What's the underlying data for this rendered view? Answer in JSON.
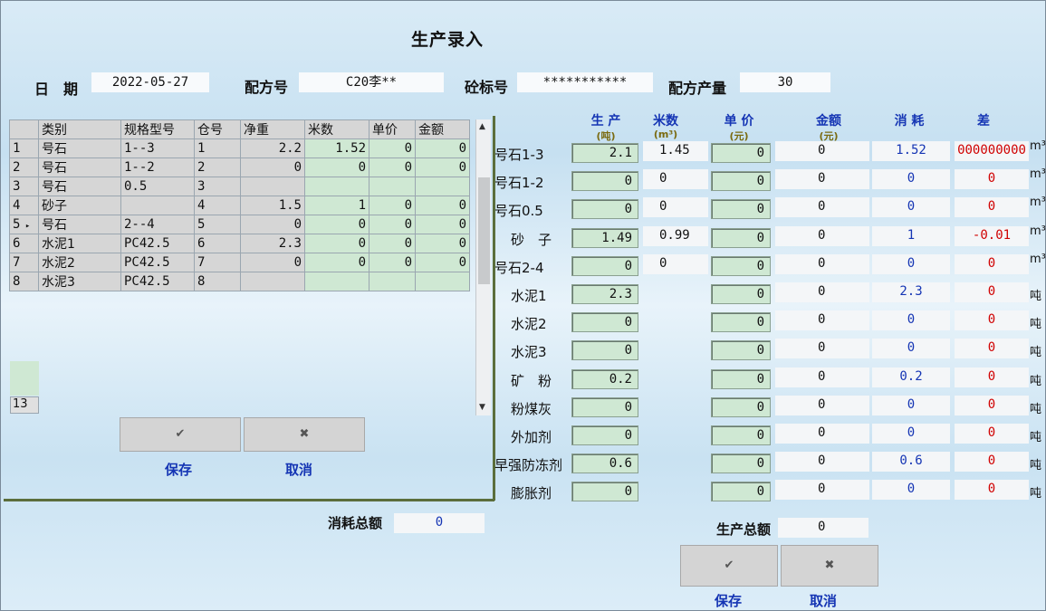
{
  "title": "生产录入",
  "header": {
    "date_label": "日　期",
    "date_value": "2022-05-27",
    "recipe_label": "配方号",
    "recipe_value": "C20李**",
    "grade_label": "砼标号",
    "grade_value": "***********",
    "output_label": "配方产量",
    "output_value": "30"
  },
  "grid": {
    "columns": [
      "类别",
      "规格型号",
      "仓号",
      "净重",
      "米数",
      "单价",
      "金额"
    ],
    "rows": [
      {
        "idx": "1",
        "cat": "号石",
        "spec": "1--3",
        "bin": "1",
        "net": "2.2",
        "m": "1.52",
        "price": "0",
        "amount": "0"
      },
      {
        "idx": "2",
        "cat": "号石",
        "spec": "1--2",
        "bin": "2",
        "net": "0",
        "m": "0",
        "price": "0",
        "amount": "0"
      },
      {
        "idx": "3",
        "cat": "号石",
        "spec": "0.5",
        "bin": "3",
        "net": "",
        "m": "",
        "price": "",
        "amount": ""
      },
      {
        "idx": "4",
        "cat": "砂子",
        "spec": "",
        "bin": "4",
        "net": "1.5",
        "m": "1",
        "price": "0",
        "amount": "0"
      },
      {
        "idx": "5",
        "cat": "号石",
        "spec": "2--4",
        "bin": "5",
        "net": "0",
        "m": "0",
        "price": "0",
        "amount": "0"
      },
      {
        "idx": "6",
        "cat": "水泥1",
        "spec": "PC42.5",
        "bin": "6",
        "net": "2.3",
        "m": "0",
        "price": "0",
        "amount": "0"
      },
      {
        "idx": "7",
        "cat": "水泥2",
        "spec": "PC42.5",
        "bin": "7",
        "net": "0",
        "m": "0",
        "price": "0",
        "amount": "0"
      },
      {
        "idx": "8",
        "cat": "水泥3",
        "spec": "PC42.5",
        "bin": "8",
        "net": "",
        "m": "",
        "price": "",
        "amount": ""
      }
    ],
    "row13_idx": "13"
  },
  "left_buttons": {
    "ok_glyph": "✔",
    "cancel_glyph": "✖",
    "save_label": "保存",
    "cancel_label": "取消"
  },
  "consume_total_label": "消耗总额",
  "consume_total_value": "0",
  "right": {
    "col_headers": {
      "prod": "生 产",
      "prod_unit": "(吨)",
      "meters": "米数",
      "meters_unit": "(m³)",
      "price": "单 价",
      "price_unit": "(元)",
      "amount": "金额",
      "amount_unit": "(元)",
      "consume": "消 耗",
      "diff": "差"
    },
    "rows": [
      {
        "label": "号石1-3",
        "prod": "2.1",
        "meters": "1.45",
        "price": "0",
        "amount": "0",
        "consume": "1.52",
        "diff": "000000000",
        "unit": "m³"
      },
      {
        "label": "号石1-2",
        "prod": "0",
        "meters": "0",
        "price": "0",
        "amount": "0",
        "consume": "0",
        "diff": "0",
        "unit": "m³"
      },
      {
        "label": "号石0.5",
        "prod": "0",
        "meters": "0",
        "price": "0",
        "amount": "0",
        "consume": "0",
        "diff": "0",
        "unit": "m³"
      },
      {
        "label": "砂　子",
        "prod": "1.49",
        "meters": "0.99",
        "price": "0",
        "amount": "0",
        "consume": "1",
        "diff": "-0.01",
        "unit": "m³"
      },
      {
        "label": "号石2-4",
        "prod": "0",
        "meters": "0",
        "price": "0",
        "amount": "0",
        "consume": "0",
        "diff": "0",
        "unit": "m³"
      },
      {
        "label": "水泥1",
        "prod": "2.3",
        "price": "0",
        "amount": "0",
        "consume": "2.3",
        "diff": "0",
        "unit": "吨"
      },
      {
        "label": "水泥2",
        "prod": "0",
        "price": "0",
        "amount": "0",
        "consume": "0",
        "diff": "0",
        "unit": "吨"
      },
      {
        "label": "水泥3",
        "prod": "0",
        "price": "0",
        "amount": "0",
        "consume": "0",
        "diff": "0",
        "unit": "吨"
      },
      {
        "label": "矿　粉",
        "prod": "0.2",
        "price": "0",
        "amount": "0",
        "consume": "0.2",
        "diff": "0",
        "unit": "吨"
      },
      {
        "label": "粉煤灰",
        "prod": "0",
        "price": "0",
        "amount": "0",
        "consume": "0",
        "diff": "0",
        "unit": "吨"
      },
      {
        "label": "外加剂",
        "prod": "0",
        "price": "0",
        "amount": "0",
        "consume": "0",
        "diff": "0",
        "unit": "吨"
      },
      {
        "label": "早强防冻剂",
        "prod": "0.6",
        "price": "0",
        "amount": "0",
        "consume": "0.6",
        "diff": "0",
        "unit": "吨"
      },
      {
        "label": "膨胀剂",
        "prod": "0",
        "price": "0",
        "amount": "0",
        "consume": "0",
        "diff": "0",
        "unit": "吨"
      }
    ]
  },
  "prod_total_label": "生产总额",
  "prod_total_value": "0",
  "right_buttons": {
    "ok_glyph": "✔",
    "cancel_glyph": "✖",
    "save_label": "保存",
    "cancel_label": "取消"
  }
}
